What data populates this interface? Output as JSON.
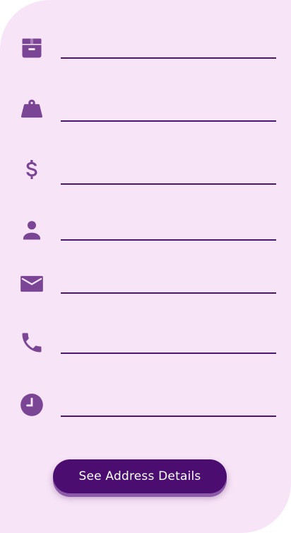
{
  "colors": {
    "background": "#f8e4f7",
    "icon": "#7a4595",
    "underline": "#4a1670",
    "button": "#4b0d70",
    "button_text": "#ffffff"
  },
  "form": {
    "fields": [
      {
        "icon": "package-icon",
        "value": "",
        "placeholder": ""
      },
      {
        "icon": "weight-icon",
        "value": "",
        "placeholder": ""
      },
      {
        "icon": "dollar-icon",
        "value": "",
        "placeholder": ""
      },
      {
        "icon": "person-icon",
        "value": "",
        "placeholder": ""
      },
      {
        "icon": "mail-icon",
        "value": "",
        "placeholder": ""
      },
      {
        "icon": "phone-icon",
        "value": "",
        "placeholder": ""
      },
      {
        "icon": "clock-icon",
        "value": "",
        "placeholder": ""
      }
    ]
  },
  "actions": {
    "see_address_label": "See Address Details"
  }
}
